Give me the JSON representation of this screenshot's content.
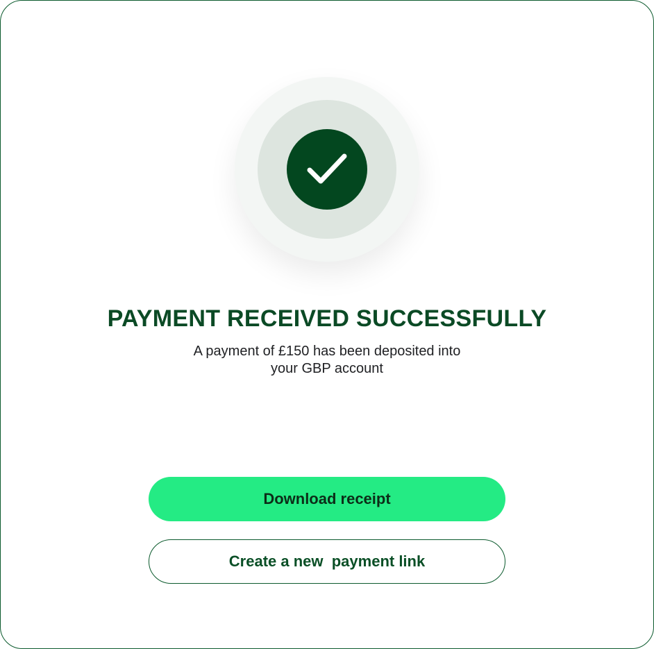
{
  "status": {
    "icon": "check-icon",
    "title": "PAYMENT RECEIVED SUCCESSFULLY",
    "message_line1": "A payment of £150 has been deposited into",
    "message_line2": "your GBP account"
  },
  "actions": {
    "download_label": "Download receipt",
    "create_link_label": "Create a new  payment link"
  },
  "colors": {
    "brand_dark": "#03471f",
    "accent": "#24eb84"
  }
}
